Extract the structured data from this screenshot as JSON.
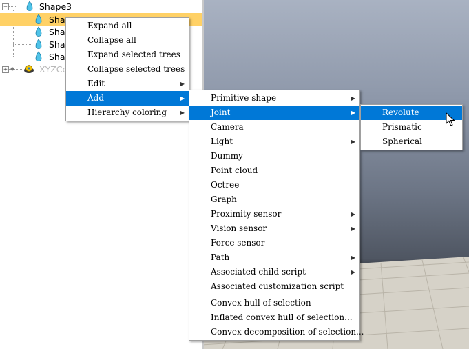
{
  "tree": {
    "root": {
      "label": "Shape3"
    },
    "children": [
      {
        "label": "Shape",
        "selected": true
      },
      {
        "label": "Shape",
        "selected": false
      },
      {
        "label": "Shape",
        "selected": false
      },
      {
        "label": "Shape",
        "selected": false
      }
    ],
    "sibling": {
      "label": "XYZCo"
    }
  },
  "context_menu": {
    "items": [
      "Expand all",
      "Collapse all",
      "Expand selected trees",
      "Collapse selected trees",
      "Edit",
      "Add",
      "Hierarchy coloring"
    ]
  },
  "add_menu": {
    "items": [
      "Primitive shape",
      "Joint",
      "Camera",
      "Light",
      "Dummy",
      "Point cloud",
      "Octree",
      "Graph",
      "Proximity sensor",
      "Vision sensor",
      "Force sensor",
      "Path",
      "Associated child script",
      "Associated customization script",
      "Convex hull of selection",
      "Inflated convex hull of selection...",
      "Convex decomposition of selection..."
    ]
  },
  "joint_menu": {
    "items": [
      "Revolute",
      "Prismatic",
      "Spherical"
    ]
  },
  "colors": {
    "menu_highlight": "#0078d7",
    "tree_selection": "#ffd166",
    "shape_icon": "#4fc3e8"
  }
}
